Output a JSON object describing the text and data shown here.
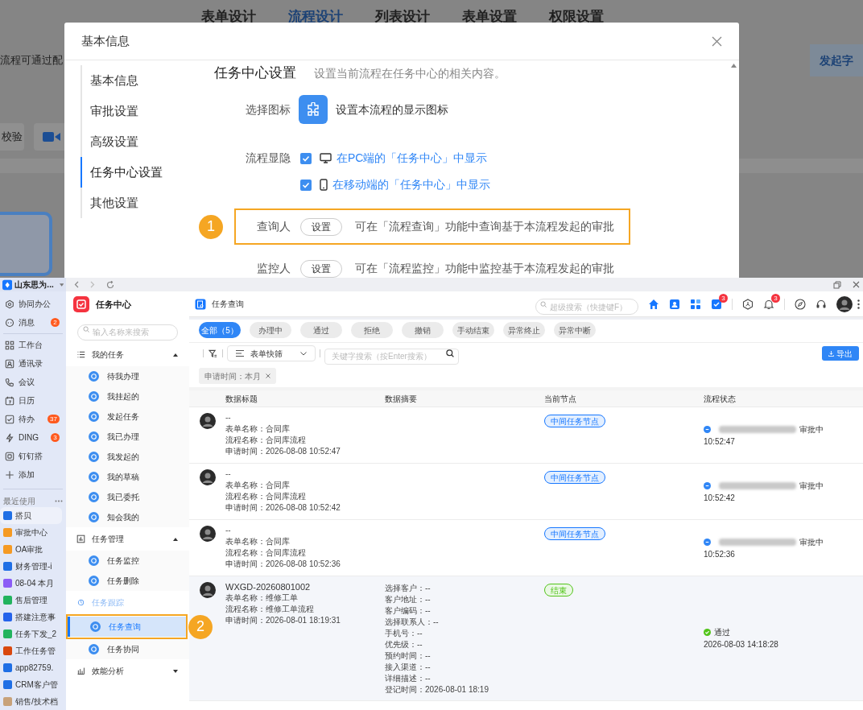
{
  "background_page": {
    "tabs": [
      {
        "label": "表单设计",
        "selected": false
      },
      {
        "label": "流程设计",
        "selected": true
      },
      {
        "label": "列表设计",
        "selected": false
      },
      {
        "label": "表单设置",
        "selected": false
      },
      {
        "label": "权限设置",
        "selected": false
      }
    ],
    "notice": "流程可通过配",
    "left_button": "校验",
    "right_button": "发起字"
  },
  "dialog": {
    "title": "基本信息",
    "nav": [
      {
        "label": "基本信息",
        "selected": false
      },
      {
        "label": "审批设置",
        "selected": false
      },
      {
        "label": "高级设置",
        "selected": false
      },
      {
        "label": "任务中心设置",
        "selected": true
      },
      {
        "label": "其他设置",
        "selected": false
      }
    ],
    "section_title": "任务中心设置",
    "section_description": "设置当前流程在任务中心的相关内容。",
    "rows": [
      {
        "kind": "icon",
        "label": "选择图标",
        "text": "设置本流程的显示图标"
      },
      {
        "kind": "checkbox",
        "label": "流程显隐",
        "checked": true,
        "text": "在PC端的「任务中心」中显示"
      },
      {
        "kind": "checkbox",
        "checked": true,
        "text": "在移动端的「任务中心」中显示"
      },
      {
        "kind": "setting",
        "label": "查询人",
        "button": "设置",
        "text": "可在「流程查询」功能中查询基于本流程发起的审批",
        "callout": "1"
      },
      {
        "kind": "setting",
        "label": "监控人",
        "button": "设置",
        "text": "可在「流程监控」功能中监控基于本流程发起的审批"
      }
    ]
  },
  "app": {
    "sidebar": {
      "org": "山东思为...",
      "nav": [
        {
          "label": "协同办公"
        },
        {
          "label": "消息",
          "badge": "2"
        },
        {
          "label": "工作台"
        },
        {
          "label": "通讯录"
        },
        {
          "label": "会议"
        },
        {
          "label": "日历"
        },
        {
          "label": "待办",
          "badge": "37"
        },
        {
          "label": "DING",
          "badge": "3"
        },
        {
          "label": "钉钉搭"
        },
        {
          "label": "添加"
        }
      ],
      "recent_title": "最近使用",
      "recent": [
        {
          "label": "搭贝",
          "color": "#1f6fe5",
          "selected": true
        },
        {
          "label": "审批中心",
          "color": "#f59a23",
          "selected": false
        },
        {
          "label": "OA审批",
          "color": "#f59a23",
          "selected": false
        },
        {
          "label": "财务管理-i",
          "color": "#1f6fe5",
          "selected": false
        },
        {
          "label": "08-04 本月",
          "color": "#8b5cf6",
          "selected": false
        },
        {
          "label": "售后管理",
          "color": "#22b35e",
          "selected": false
        },
        {
          "label": "搭建注意事",
          "color": "#2563eb",
          "selected": false
        },
        {
          "label": "任务下发_2",
          "color": "#22b35e",
          "selected": false
        },
        {
          "label": "工作任务管",
          "color": "#d9480f",
          "selected": false
        },
        {
          "label": "app82759.",
          "color": "#1f6fe5",
          "selected": false
        },
        {
          "label": "CRM客户管",
          "color": "#1f6fe5",
          "selected": false
        },
        {
          "label": "销售/技术档",
          "color": "#c8a27a",
          "selected": false
        }
      ]
    },
    "task_nav": {
      "title": "任务中心",
      "search_placeholder": "输入名称来搜索",
      "groups": [
        {
          "label": "我的任务",
          "selected": false,
          "expanded": true,
          "items": [
            {
              "label": "待我办理",
              "selected": false
            },
            {
              "label": "我挂起的",
              "selected": false
            },
            {
              "label": "发起任务",
              "selected": false
            },
            {
              "label": "我已办理",
              "selected": false
            },
            {
              "label": "我发起的",
              "selected": false
            },
            {
              "label": "我的草稿",
              "selected": false
            },
            {
              "label": "我已委托",
              "selected": false
            },
            {
              "label": "知会我的",
              "selected": false
            }
          ]
        },
        {
          "label": "任务管理",
          "selected": false,
          "expanded": true,
          "items": [
            {
              "label": "任务监控",
              "selected": false
            },
            {
              "label": "任务删除",
              "selected": false
            }
          ]
        },
        {
          "label": "任务跟踪",
          "selected": true,
          "items": [
            {
              "label": "任务查询",
              "selected": true,
              "callout": "2"
            },
            {
              "label": "任务协同",
              "selected": false
            }
          ]
        },
        {
          "label": "效能分析",
          "selected": false,
          "expanded": false
        }
      ]
    },
    "main": {
      "title": "任务查询",
      "search_placeholder": "超级搜索（快捷键F）",
      "tasks_badge": "3",
      "bell_badge": "3",
      "filters": [
        {
          "label": "全部（5）",
          "selected": true
        },
        {
          "label": "办理中",
          "selected": false
        },
        {
          "label": "通过",
          "selected": false
        },
        {
          "label": "拒绝",
          "selected": false
        },
        {
          "label": "撤销",
          "selected": false
        },
        {
          "label": "手动结束",
          "selected": false
        },
        {
          "label": "异常终止",
          "selected": false
        },
        {
          "label": "异常中断",
          "selected": false
        }
      ],
      "quick_filter": "表单快筛",
      "keyword_placeholder": "关键字搜索（按Enter搜索）",
      "export_button": "导出",
      "chip": "申请时间：本月",
      "table": {
        "columns": [
          "数据标题",
          "数据摘要",
          "当前节点",
          "流程状态"
        ],
        "rows": [
          {
            "title": "--",
            "form": "表单名称：合同库",
            "process": "流程名称：合同库流程",
            "time": "申请时间：2026-08-08 10:52:47",
            "node": "中间任务节点",
            "color": "#1677ff",
            "status": {
              "kind": "pending",
              "redacted": true,
              "text": "审批中",
              "time": "10:52:47"
            },
            "highlighted": false
          },
          {
            "title": "--",
            "form": "表单名称：合同库",
            "process": "流程名称：合同库流程",
            "time": "申请时间：2026-08-08 10:52:42",
            "node": "中间任务节点",
            "color": "#1677ff",
            "status": {
              "kind": "pending",
              "redacted": true,
              "text": "审批中",
              "time": "10:52:42"
            },
            "highlighted": false
          },
          {
            "title": "--",
            "form": "表单名称：合同库",
            "process": "流程名称：合同库流程",
            "time": "申请时间：2026-08-08 10:52:36",
            "node": "中间任务节点",
            "color": "#1677ff",
            "status": {
              "kind": "pending",
              "redacted": true,
              "text": "审批中",
              "time": "10:52:36"
            },
            "highlighted": false
          },
          {
            "title": "WXGD-20260801002",
            "form": "表单名称：维修工单",
            "process": "流程名称：维修工单流程",
            "time": "申请时间：2026-08-01 18:19:31",
            "summary": [
              "选择客户：--",
              "客户地址：--",
              "客户编码：--",
              "选择联系人：--",
              "手机号：--",
              "优先级：--",
              "预约时间：--",
              "接入渠道：--",
              "详细描述：--",
              "登记时间：2026-08-01 18:19"
            ],
            "node": "结束",
            "color": "#52c41a",
            "status": {
              "kind": "approved",
              "redacted": false,
              "text": "通过",
              "time": "2026-08-03 14:18:28"
            },
            "highlighted": true
          }
        ]
      }
    }
  }
}
